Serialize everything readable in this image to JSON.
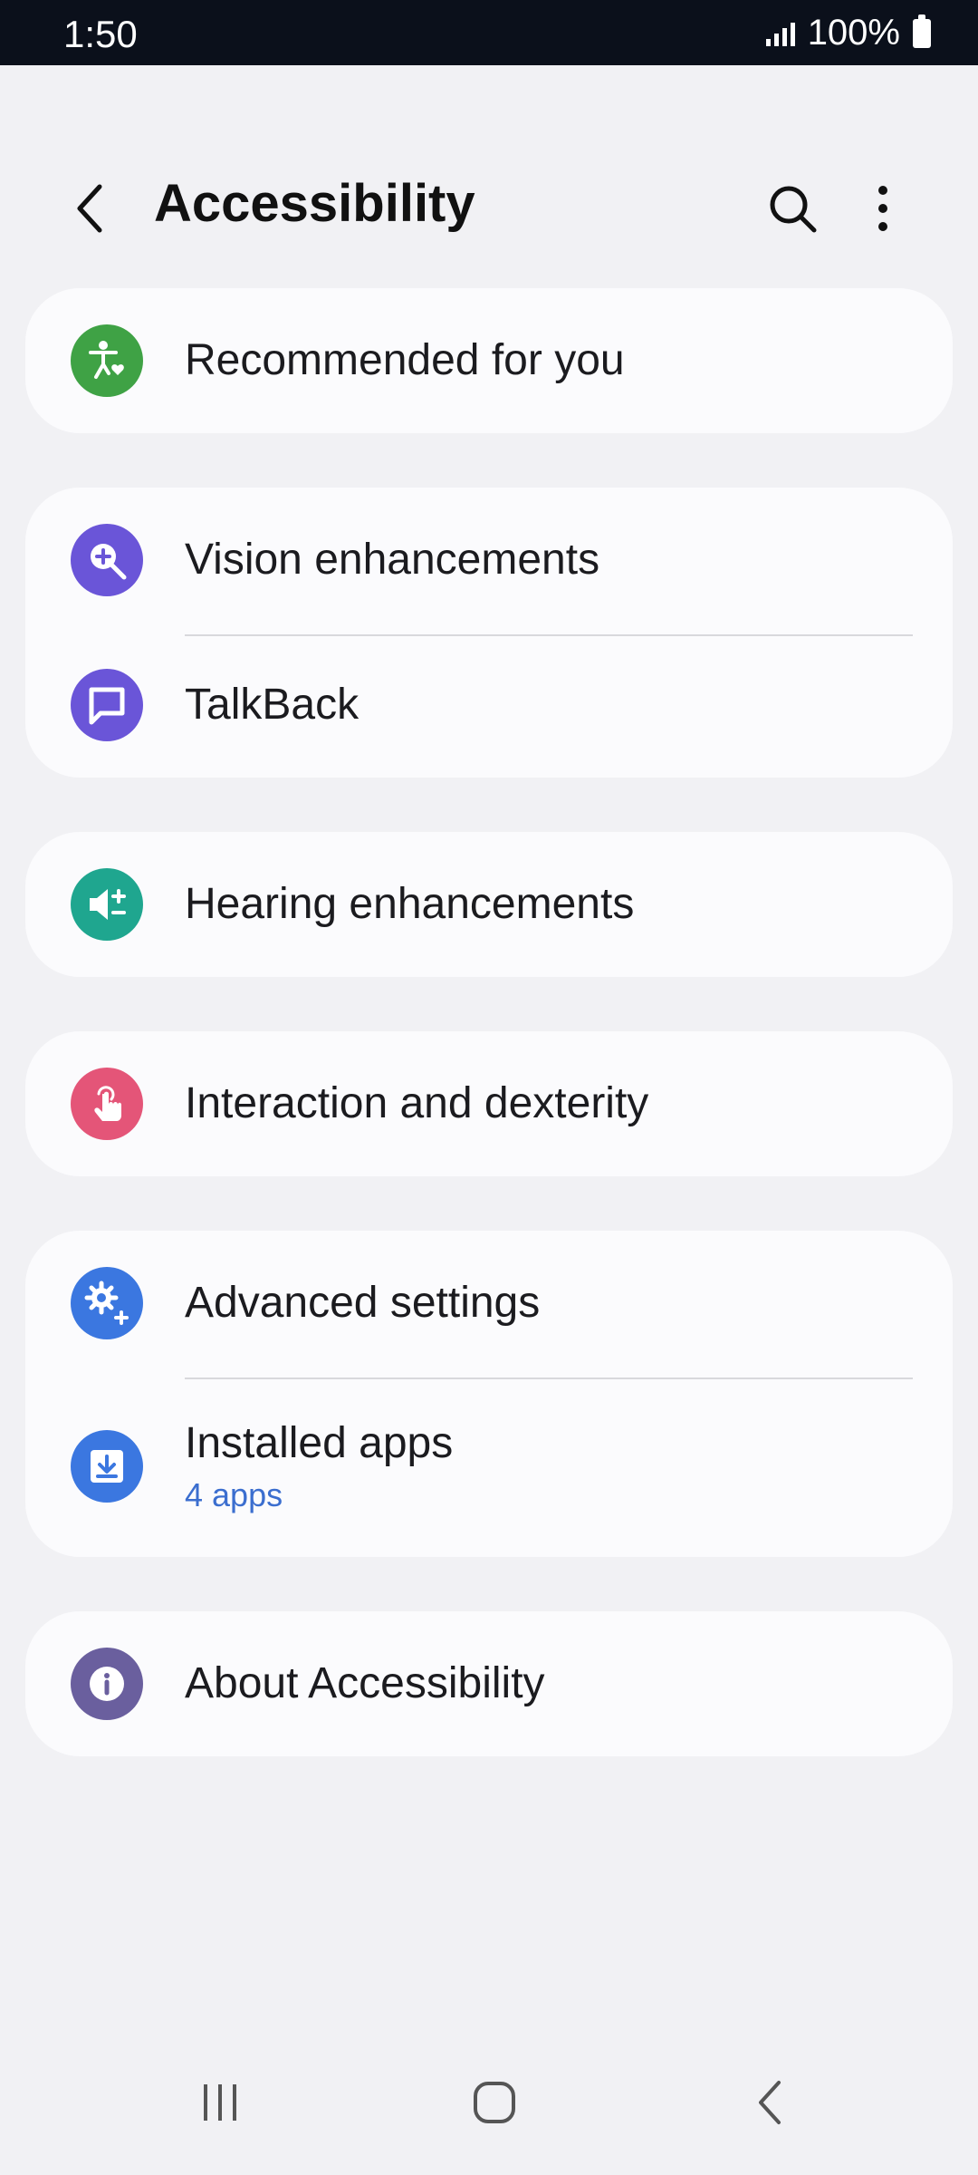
{
  "status": {
    "time": "1:50",
    "battery": "100%"
  },
  "header": {
    "title": "Accessibility"
  },
  "items": {
    "recommended": {
      "label": "Recommended for you",
      "color": "#3fa245"
    },
    "vision": {
      "label": "Vision enhancements",
      "color": "#6a55d8"
    },
    "talkback": {
      "label": "TalkBack",
      "color": "#6a55d8"
    },
    "hearing": {
      "label": "Hearing enhancements",
      "color": "#1fa68f"
    },
    "interaction": {
      "label": "Interaction and dexterity",
      "color": "#e45578"
    },
    "advanced": {
      "label": "Advanced settings",
      "color": "#3b77e0"
    },
    "installed": {
      "label": "Installed apps",
      "sub": "4 apps",
      "color": "#3b77e0"
    },
    "about": {
      "label": "About Accessibility",
      "color": "#6a5f9e"
    }
  },
  "icons": [
    "back-icon",
    "search-icon",
    "more-icon",
    "accessibility-person-icon",
    "zoom-in-icon",
    "chat-bubble-icon",
    "speaker-icon",
    "touch-hand-icon",
    "gear-plus-icon",
    "download-box-icon",
    "info-icon",
    "recents-icon",
    "home-icon",
    "nav-back-icon"
  ]
}
